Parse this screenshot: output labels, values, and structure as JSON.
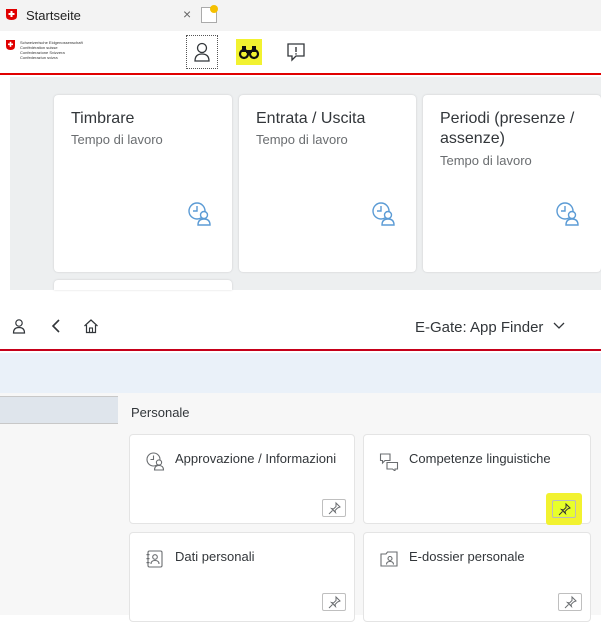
{
  "browser": {
    "tab_title": "Startseite",
    "tab_close": "×"
  },
  "logo": {
    "lines": [
      "Schweizerische Eidgenossenschaft",
      "Confédération suisse",
      "Confederazione Svizzera",
      "Confederaziun svizra"
    ]
  },
  "shellbar": {
    "icons": [
      "person-icon",
      "binoculars-icon",
      "feedback-icon"
    ],
    "highlight_color": "#f2f230",
    "accent_color": "#e00000"
  },
  "tiles": [
    {
      "title": "Timbrare",
      "subtitle": "Tempo di lavoro",
      "icon": "time-person-icon"
    },
    {
      "title": "Entrata / Uscita",
      "subtitle": "Tempo di lavoro",
      "icon": "time-person-icon"
    },
    {
      "title": "Periodi (presenze / assenze)",
      "subtitle": "Tempo di lavoro",
      "icon": "time-person-icon"
    }
  ],
  "app_finder": {
    "title": "E-Gate: App Finder",
    "section": "Personale",
    "apps": [
      {
        "label": "Approvazione / Informazioni",
        "icon": "approval-icon",
        "pinned": false
      },
      {
        "label": "Competenze linguistiche",
        "icon": "discussion-icon",
        "pinned": true
      },
      {
        "label": "Dati personali",
        "icon": "contact-card-icon",
        "pinned": false
      },
      {
        "label": "E-dossier personale",
        "icon": "dossier-icon",
        "pinned": false
      }
    ]
  }
}
